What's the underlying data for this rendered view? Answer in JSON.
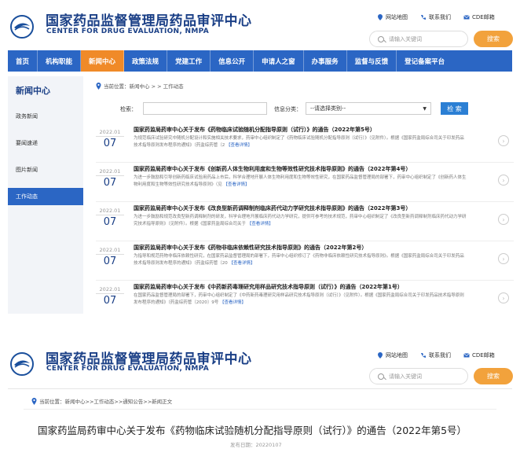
{
  "header": {
    "title_cn": "国家药品监督管理局药品审评中心",
    "title_en": "CENTER FOR DRUG EVALUATION, NMPA",
    "links": [
      "网站地图",
      "联系我们",
      "CDE邮箱"
    ],
    "search_placeholder": "请输入关键词",
    "search_button": "搜索"
  },
  "nav": {
    "items": [
      "首页",
      "机构职能",
      "新闻中心",
      "政策法规",
      "党建工作",
      "信息公开",
      "申请人之窗",
      "办事服务",
      "监督与反馈",
      "登记备案平台"
    ],
    "active_index": 2
  },
  "sidebar": {
    "title": "新闻中心",
    "items": [
      "政务新闻",
      "要闻速递",
      "图片新闻",
      "工作动态"
    ],
    "active_index": 3
  },
  "breadcrumb": "当前位置：新闻中心 > > 工作动态",
  "filter": {
    "keyword_label": "检索：",
    "category_label": "信息分类：",
    "category_value": "--请选择类别--",
    "search_button": "检 索"
  },
  "articles": [
    {
      "year_month": "2022.01",
      "day": "07",
      "title": "国家药监局药审中心关于发布《药物临床试验随机分配指导原则（试行）》的通告（2022年第5号）",
      "desc": "为规范临床试验研究中随机分配设计和实施相关技术要求，药审中心组织制定了《药物临床试验随机分配指导原则（试行）》（见附件）。根据《国家药监局综合司关于印发药品技术指导原则发布程序的通知》（药监综药管〔2",
      "more": "【查看详情】"
    },
    {
      "year_month": "2022.01",
      "day": "07",
      "title": "国家药监局药审中心关于发布《创新药人体生物利用度和生物等效性研究技术指导原则》的通告（2022年第4号）",
      "desc": "为进一步鼓励和引导创新药临床试验用药品上市后，科学合理地开展人体生物利用度和生物等效性研究，在国家药品监督管理局的部署下，药审中心组织制定了《创新药人体生物利用度和生物等效性研究技术指导原则》（见",
      "more": "【查看详情】"
    },
    {
      "year_month": "2022.01",
      "day": "07",
      "title": "国家药监局药审中心关于发布《改良型新药调释制剂临床药代动力学研究技术指导原则》的通告（2022年第3号）",
      "desc": "为进一步鼓励和规范改良型新药调释制剂的研发，科学合理地开展临床药代动力学研究，提供可参考的技术规范，药审中心组织制定了《改良型新药调释制剂临床药代动力学研究技术指导原则》（见附件）。根据《国家药监局综合司关于",
      "more": "【查看详情】"
    },
    {
      "year_month": "2022.01",
      "day": "07",
      "title": "国家药监局药审中心关于发布《药物非临床依赖性研究技术指导原则》的通告（2022年第2号）",
      "desc": "为指导和规范药物非临床依赖性研究，在国家药品监督管理局的部署下，药审中心组织修订了《药物非临床依赖性研究技术指导原则》。根据《国家药监局综合司关于印发药品技术指导原则发布程序的通知》（药监综药管〔20",
      "more": "【查看详情】"
    },
    {
      "year_month": "2022.01",
      "day": "07",
      "title": "国家药监局药审中心关于发布《中药新药毒理研究用样品研究技术指导原则（试行）》的通告（2022年第1号）",
      "desc": "在国家药品监督管理局的部署下，药审中心组织制定了《中药新药毒理研究用样品研究技术指导原则（试行）》（见附件）。根据《国家药监局综合司关于印发药品技术指导原则发布程序的通知》（药监综药管〔2020〕9号",
      "more": "【查看详情】"
    }
  ],
  "detail": {
    "breadcrumb": "当前位置：新闻中心>>工作动态>>通知公告>>新闻正文",
    "title": "国家药监局药审中心关于发布《药物临床试验随机分配指导原则（试行）》的通告（2022年第5号）",
    "date": "发布日期：20220107"
  },
  "colors": {
    "brand_blue": "#1a3f86",
    "nav_blue": "#2b66c4",
    "active_orange": "#f08a28",
    "search_orange": "#f2a23c"
  }
}
